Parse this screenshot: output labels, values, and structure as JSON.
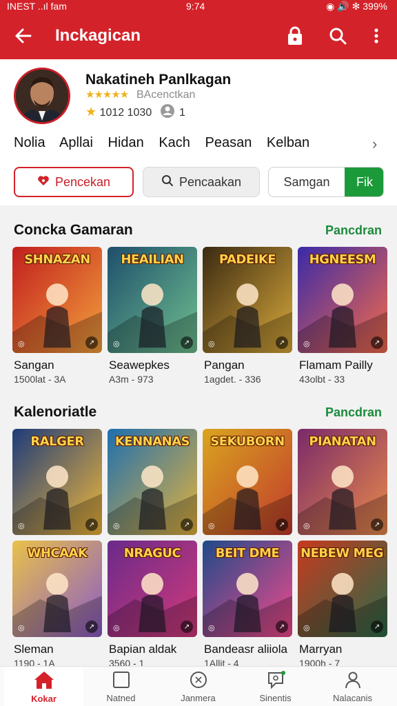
{
  "status": {
    "left": "INEST ..ıl fam",
    "time": "9:74",
    "right": "◉ 🔊 ✻ 399%"
  },
  "appbar": {
    "title": "Inckagican"
  },
  "profile": {
    "name": "Nakatineh Panlkagan",
    "developer": "BAcenctkan",
    "rating_stars": "★★★★★",
    "stat_left": "1012 1030",
    "stat_right": "1",
    "categories": [
      "Nolia",
      "Apllai",
      "Hidan",
      "Kach",
      "Peasan",
      "Kelban"
    ]
  },
  "actions": {
    "favorite_label": "Pencekan",
    "search_label": "Pencaakan",
    "seg_left": "Samgan",
    "seg_right": "Fik"
  },
  "sections": [
    {
      "title": "Concka Gamaran",
      "link": "Pancdran",
      "games": [
        {
          "art": "SHNAZAN",
          "title": "Sangan",
          "sub": "1500lat - 3A",
          "colors": [
            "#c21e1e",
            "#f2a13c"
          ]
        },
        {
          "art": "HEAILIAN",
          "title": "Seawepkes",
          "sub": "A3m - 973",
          "colors": [
            "#1e4f6b",
            "#6fbf8f"
          ]
        },
        {
          "art": "PADEIKE",
          "title": "Pangan",
          "sub": "1agdet. - 336",
          "colors": [
            "#3b2a12",
            "#d8a93b"
          ]
        },
        {
          "art": "HGNEESM",
          "title": "Flamam Pailly",
          "sub": "43olbt - 33",
          "colors": [
            "#3a2aa8",
            "#f46a4a"
          ]
        }
      ]
    },
    {
      "title": "Kalenoriatle",
      "link": "Pancdran",
      "games": [
        {
          "art": "RALGER",
          "title": "",
          "sub": "",
          "colors": [
            "#1d3b7a",
            "#f0b73a"
          ]
        },
        {
          "art": "KENNANAS",
          "title": "",
          "sub": "",
          "colors": [
            "#1e6fb0",
            "#e3b23c"
          ]
        },
        {
          "art": "SEKUBORN",
          "title": "",
          "sub": "",
          "colors": [
            "#d9a51f",
            "#c13a2c"
          ]
        },
        {
          "art": "PIANATAN",
          "title": "",
          "sub": "",
          "colors": [
            "#7a2a6a",
            "#e98a4a"
          ]
        }
      ]
    },
    {
      "title": "",
      "link": "",
      "games": [
        {
          "art": "WHCAAK",
          "title": "Sleman",
          "sub": "1190 - 1A",
          "colors": [
            "#e9c14a",
            "#8a5bc6"
          ]
        },
        {
          "art": "NRAGUC",
          "title": "Bapian aldak",
          "sub": "3560 - 1",
          "colors": [
            "#6a2a8a",
            "#d13a7a"
          ]
        },
        {
          "art": "BEIT DME",
          "title": "Bandeasr aliiola",
          "sub": "1Allit - 4",
          "colors": [
            "#1e4a8a",
            "#f24a8a"
          ]
        },
        {
          "art": "NEBEW MEGNE",
          "title": "Marryan",
          "sub": "1900h - 7",
          "colors": [
            "#c63a1e",
            "#2a6a4a"
          ]
        }
      ]
    }
  ],
  "nav": [
    {
      "label": "Kokar",
      "icon": "home-icon"
    },
    {
      "label": "Natned",
      "icon": "square-icon"
    },
    {
      "label": "Janmera",
      "icon": "compass-icon"
    },
    {
      "label": "Sinentis",
      "icon": "chat-icon"
    },
    {
      "label": "Nalacanis",
      "icon": "person-icon"
    }
  ]
}
